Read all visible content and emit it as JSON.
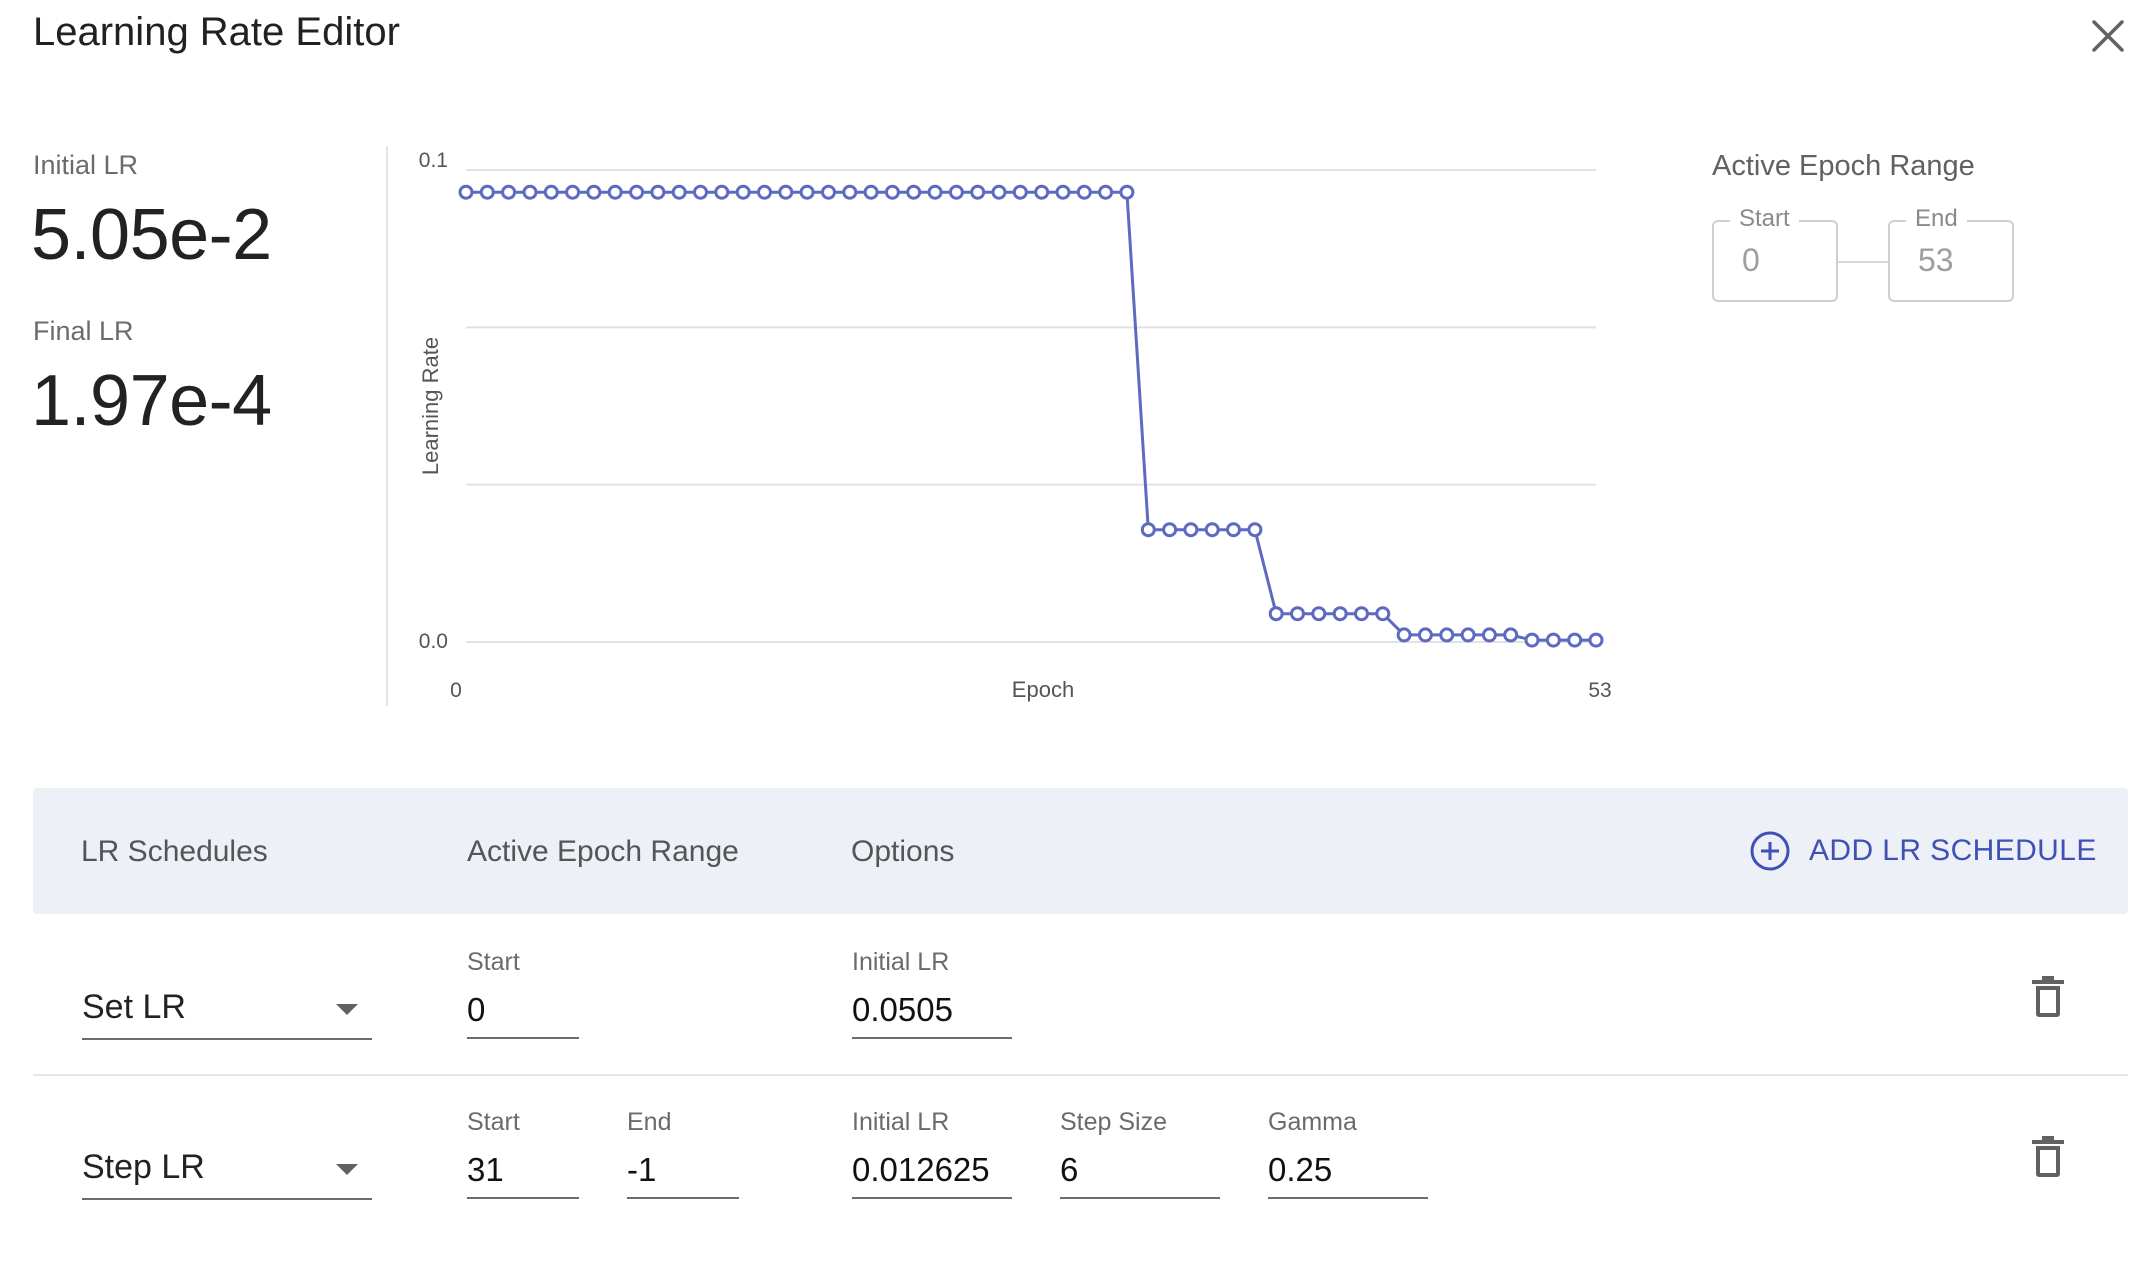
{
  "dialog": {
    "title": "Learning Rate Editor"
  },
  "stats": {
    "initial_label": "Initial LR",
    "initial_value": "5.05e-2",
    "final_label": "Final LR",
    "final_value": "1.97e-4"
  },
  "active_range": {
    "title": "Active Epoch Range",
    "start_label": "Start",
    "start_value": "0",
    "end_label": "End",
    "end_value": "53"
  },
  "chart_data": {
    "type": "line",
    "xlabel": "Epoch",
    "ylabel": "Learning Rate",
    "x_ticks": [
      "0",
      "53"
    ],
    "y_ticks": [
      "0.1",
      "0.0"
    ],
    "xlim": [
      0,
      53
    ],
    "ylim": [
      0,
      0.1
    ],
    "grid": true,
    "color": "#5c6bc0",
    "x": [
      0,
      1,
      2,
      3,
      4,
      5,
      6,
      7,
      8,
      9,
      10,
      11,
      12,
      13,
      14,
      15,
      16,
      17,
      18,
      19,
      20,
      21,
      22,
      23,
      24,
      25,
      26,
      27,
      28,
      29,
      30,
      31,
      32,
      33,
      34,
      35,
      36,
      37,
      38,
      39,
      40,
      41,
      42,
      43,
      44,
      45,
      46,
      47,
      48,
      49,
      50,
      51,
      52,
      53
    ],
    "y": [
      0.0953,
      0.0953,
      0.0953,
      0.0953,
      0.0953,
      0.0953,
      0.0953,
      0.0953,
      0.0953,
      0.0953,
      0.0953,
      0.0953,
      0.0953,
      0.0953,
      0.0953,
      0.0953,
      0.0953,
      0.0953,
      0.0953,
      0.0953,
      0.0953,
      0.0953,
      0.0953,
      0.0953,
      0.0953,
      0.0953,
      0.0953,
      0.0953,
      0.0953,
      0.0953,
      0.0953,
      0.0953,
      0.0238,
      0.0238,
      0.0238,
      0.0238,
      0.0238,
      0.0238,
      0.006,
      0.006,
      0.006,
      0.006,
      0.006,
      0.006,
      0.0015,
      0.0015,
      0.0015,
      0.0015,
      0.0015,
      0.0015,
      0.0004,
      0.0004,
      0.0004,
      0.0004,
      0.0004,
      0.0004
    ]
  },
  "schedule_header": {
    "col_schedules": "LR Schedules",
    "col_range": "Active Epoch Range",
    "col_options": "Options",
    "add_label": "ADD LR SCHEDULE"
  },
  "schedules": [
    {
      "type": "Set LR",
      "start_label": "Start",
      "start": "0",
      "init_label": "Initial LR",
      "init": "0.0505"
    },
    {
      "type": "Step LR",
      "start_label": "Start",
      "start": "31",
      "end_label": "End",
      "end": "-1",
      "init_label": "Initial LR",
      "init": "0.012625",
      "step_label": "Step Size",
      "step": "6",
      "gamma_label": "Gamma",
      "gamma": "0.25"
    }
  ],
  "colors": {
    "accent": "#3f51b5",
    "line": "#5c6bc0",
    "bar_bg": "#eef0f8"
  }
}
